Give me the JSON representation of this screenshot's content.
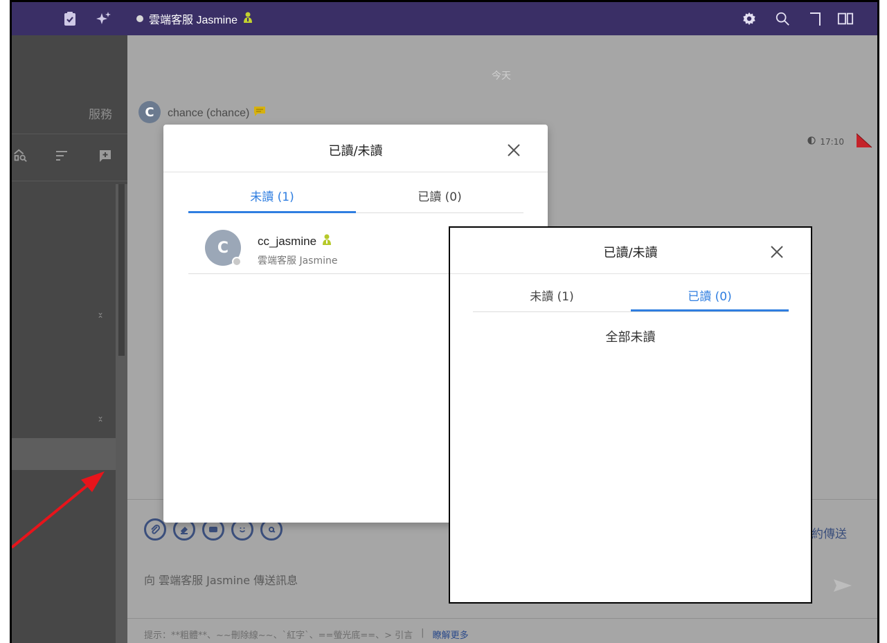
{
  "topbar": {
    "contact_name": "雲端客服 Jasmine",
    "icons": [
      "clipboard-check-icon",
      "sparkle-icon",
      "gear-icon",
      "search-icon",
      "corner-icon",
      "panels-icon"
    ]
  },
  "sidebar": {
    "service_label": "服務",
    "icons": [
      "filter-search-icon",
      "sort-icon",
      "add-chat-icon"
    ]
  },
  "chat": {
    "date_label": "今天",
    "sender_initial": "C",
    "sender_name": "chance (chance)",
    "message_time": "17:10",
    "composer_placeholder": "向 雲端客服 Jasmine 傳送訊息",
    "schedule_label": "約傳送",
    "hint_text": "提示：**粗體**、~~刪除線~~、`紅字`、==螢光底==、> 引言",
    "hint_sep": "|",
    "hint_link": "瞭解更多"
  },
  "modal1": {
    "title": "已讀/未讀",
    "tab_unread": "未讀 (1)",
    "tab_read": "已讀 (0)",
    "active_tab": "unread",
    "users": [
      {
        "initial": "C",
        "name": "cc_jasmine",
        "subtitle": "雲端客服 Jasmine"
      }
    ]
  },
  "modal2": {
    "title": "已讀/未讀",
    "tab_unread": "未讀 (1)",
    "tab_read": "已讀 (0)",
    "active_tab": "read",
    "empty_message": "全部未讀"
  },
  "colors": {
    "topbar": "#3a2f66",
    "accent": "#2f7ee0",
    "overlay": "#a6a6a6",
    "arrow": "#e8141b"
  }
}
